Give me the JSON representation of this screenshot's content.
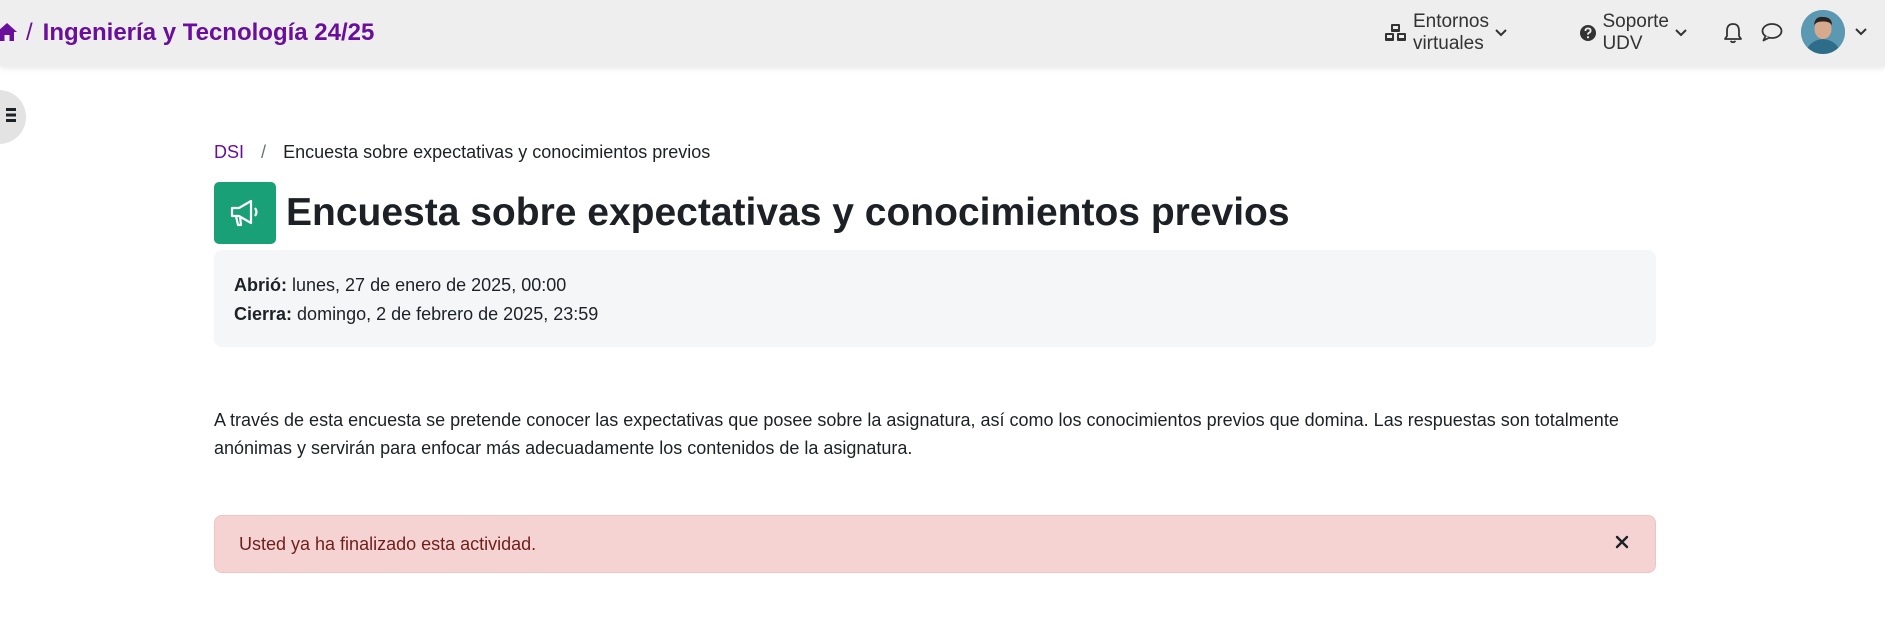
{
  "navbar": {
    "course_title": "Ingeniería y Tecnología 24/25",
    "separator": "/",
    "menus": [
      {
        "label": "Entornos virtuales",
        "icon": "cubes-icon"
      },
      {
        "label": "Soporte UDV",
        "icon": "question-circle-icon"
      }
    ],
    "icons": [
      "home-icon",
      "bell-icon",
      "chat-icon",
      "user-avatar",
      "chevron-down-icon"
    ]
  },
  "drawer": {
    "icon": "list-icon"
  },
  "breadcrumb": {
    "items": [
      "DSI",
      "Encuesta sobre expectativas y conocimientos previos"
    ],
    "divider": "/"
  },
  "page": {
    "title": "Encuesta sobre expectativas y conocimientos previos",
    "activity_icon": "megaphone-icon"
  },
  "dates": {
    "opened_label": "Abrió:",
    "opened_value": "lunes, 27 de enero de 2025, 00:00",
    "closes_label": "Cierra:",
    "closes_value": "domingo, 2 de febrero de 2025, 23:59"
  },
  "description": "A través de esta encuesta se pretende conocer las expectativas que posee sobre la asignatura, así como los conocimientos previos que domina. Las respuestas son totalmente anónimas y servirán para enfocar más adecuadamente los contenidos de la asignatura.",
  "alert": {
    "message": "Usted ya ha finalizado esta actividad.",
    "close_symbol": "×"
  },
  "colors": {
    "brand": "#6a0f9b",
    "activity_icon_bg": "#1aa076",
    "alert_bg": "#f4d3d2",
    "alert_text": "#6f1f1d",
    "navbar_bg": "#eeeeee"
  }
}
